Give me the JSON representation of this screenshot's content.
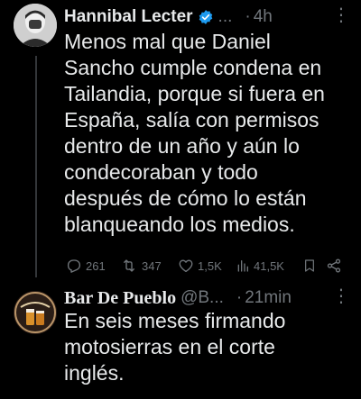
{
  "tweet1": {
    "name": "Hannibal Lecter",
    "handle_truncated": "...",
    "separator": "·",
    "time": "4h",
    "more": "⋮",
    "text": "Menos mal que Daniel\nSancho cumple condena en\nTailandia, porque si fuera en\nEspaña, salía con permisos\ndentro de un año y aún lo\ncondecoraban y todo\ndespués de cómo lo están\nblanqueando los medios.",
    "stats": {
      "replies": "261",
      "retweets": "347",
      "likes": "1,5K",
      "views": "41,5K"
    },
    "icons": [
      "avatar",
      "verified-badge-icon",
      "reply-icon",
      "retweet-icon",
      "like-icon",
      "views-icon",
      "bookmark-icon",
      "share-icon"
    ]
  },
  "tweet2": {
    "name": "Bar De Pueblo",
    "handle": "@B...",
    "separator": "·",
    "time": "21min",
    "more": "⋮",
    "text": "En seis meses firmando\nmotosierras en el corte\ninglés."
  },
  "colors": {
    "background": "#000000",
    "text": "#e7e9ea",
    "muted": "#71767b",
    "verified": "#1d9bf0"
  }
}
